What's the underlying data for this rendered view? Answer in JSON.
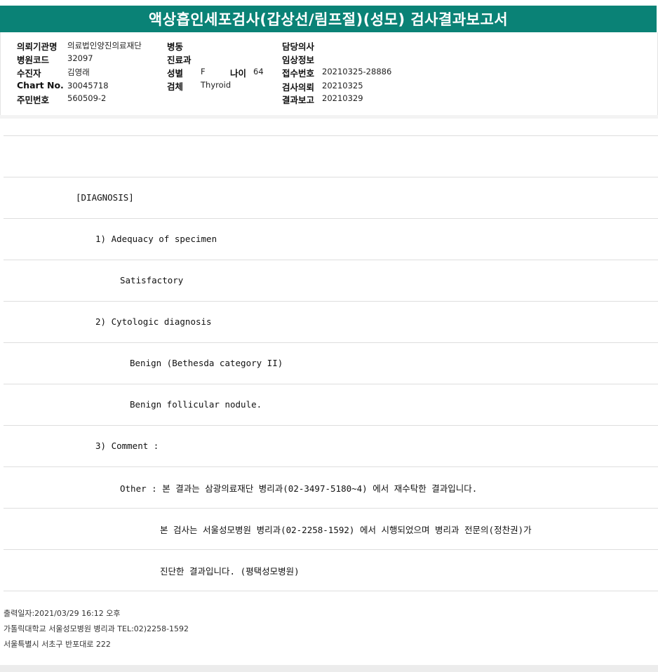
{
  "title": "액상흡인세포검사(갑상선/림프절)(성모) 검사결과보고서",
  "header": {
    "col1": [
      {
        "label": "의뢰기관명",
        "value": "의료법인양진의료재단"
      },
      {
        "label": "병원코드",
        "value": "32097"
      },
      {
        "label": "수진자",
        "value": "김영래"
      },
      {
        "label": "Chart No.",
        "value": "30045718"
      },
      {
        "label": "주민번호",
        "value": "560509-2"
      }
    ],
    "col2": [
      {
        "label": "병동",
        "value": ""
      },
      {
        "label": "진료과",
        "value": ""
      },
      {
        "label": "성별",
        "value": "F"
      },
      {
        "label": "검체",
        "value": "Thyroid"
      }
    ],
    "age": {
      "label": "나이",
      "value": "64"
    },
    "col3": [
      {
        "label": "담당의사",
        "value": ""
      },
      {
        "label": "임상정보",
        "value": ""
      },
      {
        "label": "접수번호",
        "value": "20210325-28886"
      },
      {
        "label": "검사의뢰",
        "value": "20210325"
      },
      {
        "label": "결과보고",
        "value": "20210329"
      }
    ]
  },
  "report_lines": [
    "",
    "[DIAGNOSIS]",
    "1) Adequacy of specimen",
    "Satisfactory",
    "2) Cytologic diagnosis",
    "Benign (Bethesda category II)",
    "Benign follicular nodule.",
    "3) Comment :",
    "Other : 본 결과는 삼광의료재단 병리과(02-3497-5180~4) 에서 재수탁한 결과입니다.",
    "본 검사는 서울성모병원 병리과(02-2258-1592) 에서 시행되었으며 병리과 전문의(정찬권)가",
    "진단한 결과입니다. (평택성모병원)"
  ],
  "footer": {
    "print_date": "출력일자:2021/03/29 16:12 오후",
    "institution": "가톨릭대학교 서울성모병원 병리과 TEL:02)2258-1592",
    "address": "서울특별시 서초구 반포대로 222"
  }
}
